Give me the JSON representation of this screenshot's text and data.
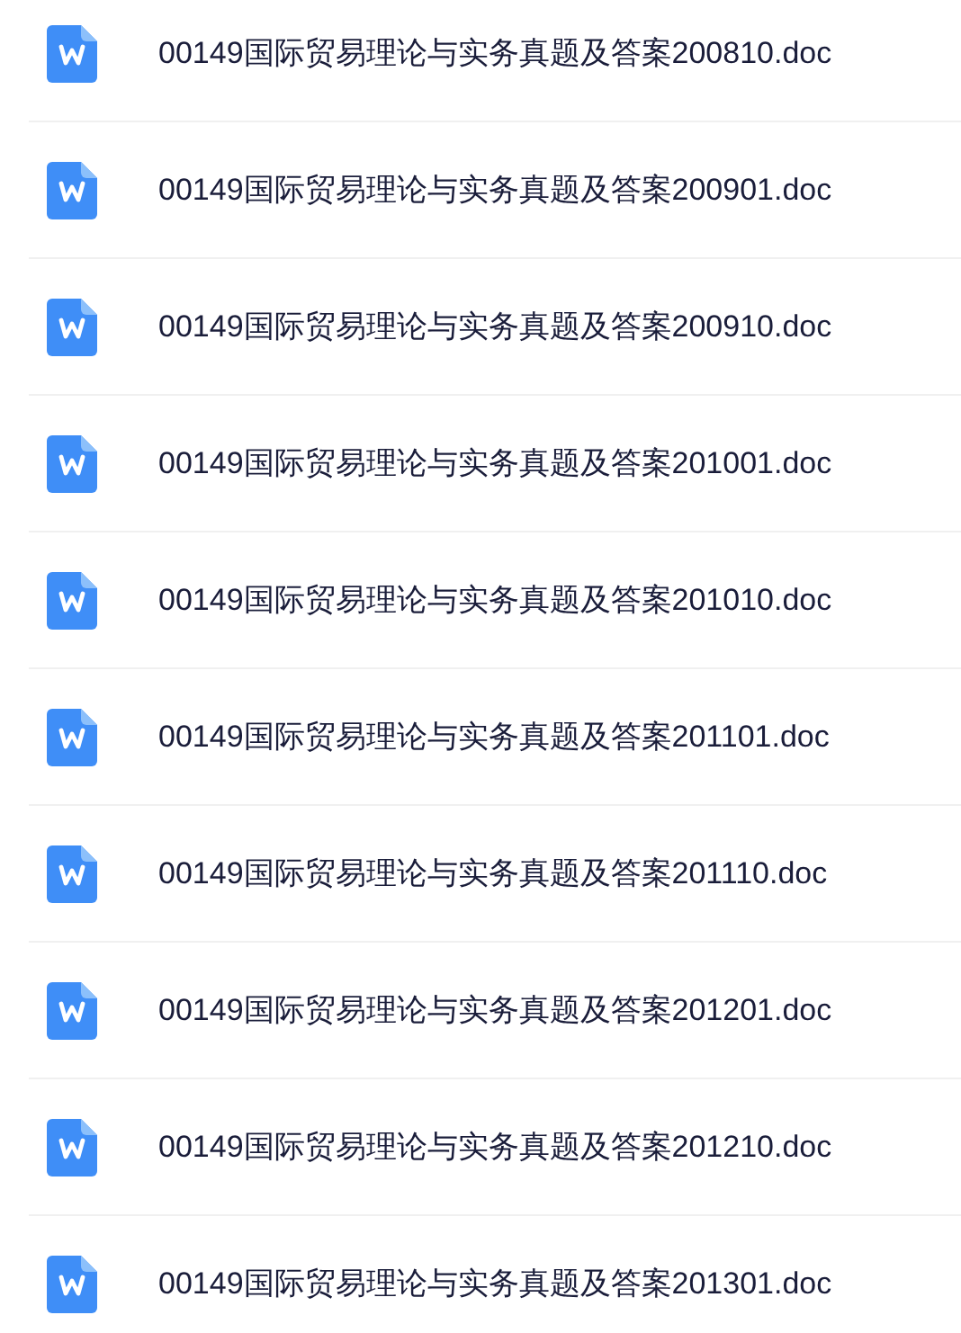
{
  "files": [
    {
      "name": "00149国际贸易理论与实务真题及答案200810.doc"
    },
    {
      "name": "00149国际贸易理论与实务真题及答案200901.doc"
    },
    {
      "name": "00149国际贸易理论与实务真题及答案200910.doc"
    },
    {
      "name": "00149国际贸易理论与实务真题及答案201001.doc"
    },
    {
      "name": "00149国际贸易理论与实务真题及答案201010.doc"
    },
    {
      "name": "00149国际贸易理论与实务真题及答案201101.doc"
    },
    {
      "name": "00149国际贸易理论与实务真题及答案201110.doc"
    },
    {
      "name": "00149国际贸易理论与实务真题及答案201201.doc"
    },
    {
      "name": "00149国际贸易理论与实务真题及答案201210.doc"
    },
    {
      "name": "00149国际贸易理论与实务真题及答案201301.doc"
    }
  ]
}
